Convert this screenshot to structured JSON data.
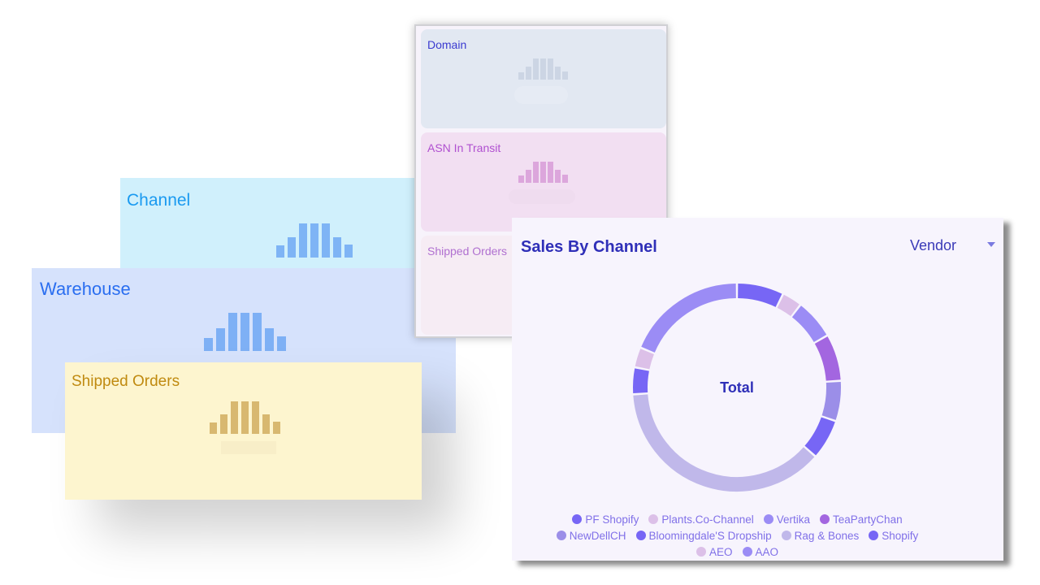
{
  "cards": {
    "channel": {
      "title": "Channel"
    },
    "warehouse": {
      "title": "Warehouse"
    },
    "shipped": {
      "title": "Shipped Orders"
    }
  },
  "tiles": {
    "domain": {
      "title": "Domain"
    },
    "asn": {
      "title": "ASN In Transit"
    },
    "shipped": {
      "title": "Shipped Orders"
    }
  },
  "sales": {
    "title": "Sales By Channel",
    "dropdown": "Vendor",
    "center_label": "Total"
  },
  "chart_data": {
    "type": "pie",
    "title": "Sales By Channel",
    "center_label": "Total",
    "legend_position": "bottom",
    "series": [
      {
        "name": "PF Shopify",
        "value": 7,
        "color": "#7766f5"
      },
      {
        "name": "Plants.Co-Channel",
        "value": 3,
        "color": "#dcc0e8"
      },
      {
        "name": "Vertika",
        "value": 6,
        "color": "#9b8cf5"
      },
      {
        "name": "TeaPartyChan",
        "value": 7,
        "color": "#a366e0"
      },
      {
        "name": "NewDellCH",
        "value": 6,
        "color": "#9b8ee8"
      },
      {
        "name": "Bloomingdale'S Dropship",
        "value": 6,
        "color": "#7766f5"
      },
      {
        "name": "Rag & Bones",
        "value": 36,
        "color": "#c0b8ea"
      },
      {
        "name": "Shopify",
        "value": 4,
        "color": "#7766f5"
      },
      {
        "name": "AEO",
        "value": 3,
        "color": "#dcc0e8"
      },
      {
        "name": "AAO",
        "value": 18,
        "color": "#9b8cf5"
      }
    ]
  }
}
